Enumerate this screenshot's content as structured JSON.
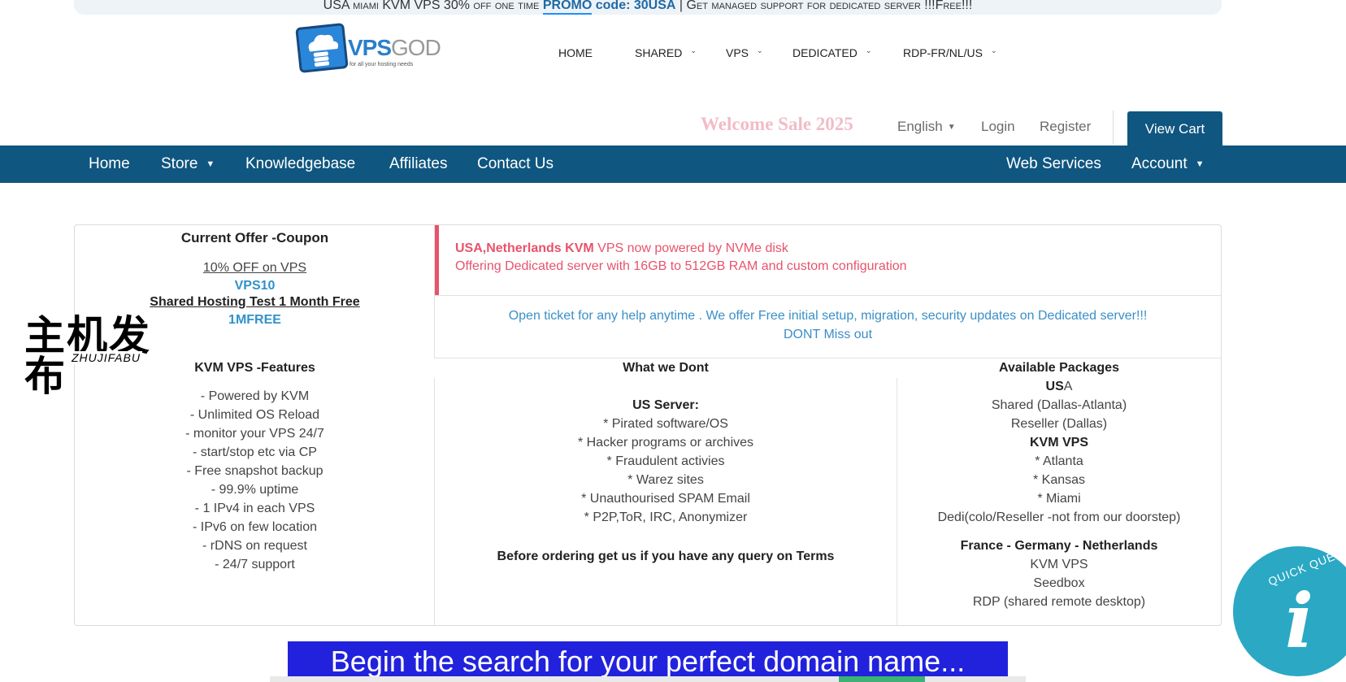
{
  "promo": {
    "part1": "USA miami KVM VPS 30% off one time ",
    "promo_word": "PROMO",
    "code_label": " code: 30USA",
    "part2": " | Get managed support for dedicated server !!!Free!!!"
  },
  "logo": {
    "name_a": "VPS",
    "name_b": "GOD",
    "tagline": "for all your hosting needs"
  },
  "topnav": [
    {
      "label": "HOME",
      "dropdown": false
    },
    {
      "label": "SHARED",
      "dropdown": true
    },
    {
      "label": "VPS",
      "dropdown": true
    },
    {
      "label": "DEDICATED",
      "dropdown": true
    },
    {
      "label": "RDP-FR/NL/US",
      "dropdown": true
    }
  ],
  "utility": {
    "welcome": "Welcome Sale 2025",
    "language": "English",
    "login": "Login",
    "register": "Register",
    "view_cart": "View Cart"
  },
  "mainnav": {
    "left": [
      {
        "label": "Home",
        "dropdown": false
      },
      {
        "label": "Store",
        "dropdown": true
      },
      {
        "label": "Knowledgebase",
        "dropdown": false
      },
      {
        "label": "Affiliates",
        "dropdown": false
      },
      {
        "label": "Contact Us",
        "dropdown": false
      }
    ],
    "right": [
      {
        "label": "Web Services",
        "dropdown": false
      },
      {
        "label": "Account",
        "dropdown": true
      }
    ]
  },
  "coupon": {
    "title": "Current Offer -Coupon",
    "offer1": "10% OFF on VPS",
    "code1": "VPS10",
    "offer2": "Shared Hosting Test 1 Month Free",
    "code2": "1MFREE"
  },
  "alert": {
    "bold": "USA,Netherlands KVM",
    "rest": " VPS now powered by NVMe disk",
    "line2": "Offering Dedicated server with 16GB to 512GB RAM and custom configuration"
  },
  "ticket": {
    "line1": "Open ticket for any help anytime . We offer Free initial setup, migration, security updates on Dedicated server!!!",
    "line2": "DONT Miss out"
  },
  "features": {
    "title": "KVM VPS -Features",
    "items": [
      "- Powered by KVM",
      "- Unlimited OS Reload",
      "- monitor your VPS 24/7",
      "- start/stop etc via CP",
      "- Free snapshot backup",
      "- 99.9% uptime",
      "- 1 IPv4 in each VPS",
      "- IPv6 on few location",
      "- rDNS on request",
      "- 24/7 support"
    ]
  },
  "dont": {
    "title": "What we Dont",
    "subtitle": "US Server:",
    "items": [
      "* Pirated software/OS",
      "* Hacker programs or archives",
      "* Fraudulent activies",
      "* Warez sites",
      "* Unauthourised SPAM Email",
      "* P2P,ToR, IRC, Anonymizer"
    ],
    "footer": "Before ordering get us if you have any query on Terms"
  },
  "packages": {
    "title": "Available Packages",
    "usa_bold": "US",
    "usa_rest": "A",
    "usa_items": [
      "Shared (Dallas-Atlanta)",
      "Reseller (Dallas)"
    ],
    "kvm_title": "KVM VPS",
    "kvm_items": [
      "* Atlanta",
      "* Kansas",
      "* Miami"
    ],
    "dedi": "Dedi(colo/Reseller -not from our doorstep)",
    "eu_title": "France - Germany - Netherlands",
    "eu_items": [
      "KVM VPS",
      "Seedbox",
      "RDP (shared remote desktop)"
    ]
  },
  "watermark": {
    "cn": "主机发布",
    "en": "ZHUJIFABU"
  },
  "domain": {
    "headline": "Begin the search for your perfect domain name..."
  },
  "quick": {
    "label": "QUICK QUEST",
    "glyph": "i"
  }
}
